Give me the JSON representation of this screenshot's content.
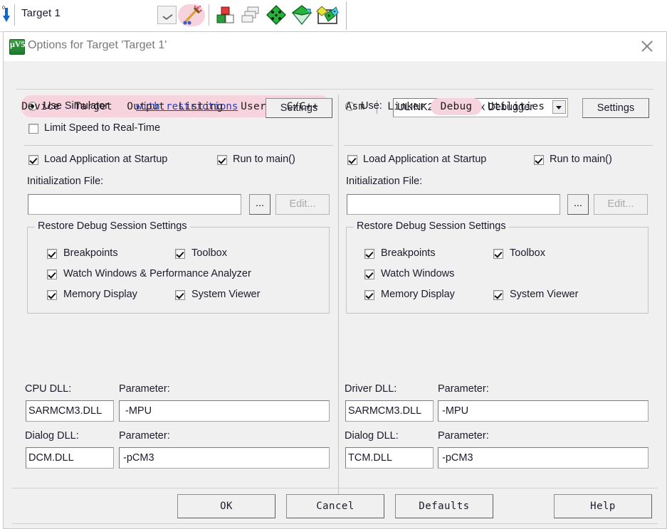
{
  "ide_toolbar": {
    "target_selector_value": "Target 1",
    "icons": [
      {
        "name": "download-arrow-icon"
      },
      {
        "name": "dropdown-arrow-icon"
      },
      {
        "name": "magic-wand-target-options-icon",
        "highlighted": true
      },
      {
        "name": "build-target-icon"
      },
      {
        "name": "batch-build-icon"
      },
      {
        "name": "manage-components-icon"
      },
      {
        "name": "pack-filter-icon"
      },
      {
        "name": "pack-installer-icon"
      }
    ]
  },
  "dialog": {
    "title": "Options for Target 'Target 1'",
    "app_icon_text": "μV5",
    "close_label": "✕"
  },
  "tabs": {
    "items": [
      {
        "label": "Device",
        "selected": false
      },
      {
        "label": "Target",
        "selected": false
      },
      {
        "label": "Output",
        "selected": false
      },
      {
        "label": "Listing",
        "selected": false
      },
      {
        "label": "User",
        "selected": false
      },
      {
        "label": "C/C++",
        "selected": false
      },
      {
        "label": "Asm",
        "selected": false
      },
      {
        "label": "Linker",
        "selected": false
      },
      {
        "label": "Debug",
        "selected": true
      },
      {
        "label": "Utilities",
        "selected": false
      }
    ],
    "selected_label": "Debug"
  },
  "left_panel": {
    "use_simulator_label": "Use Simulator",
    "use_simulator_checked": true,
    "with_restrictions_link": "with restrictions",
    "settings_button": "Settings",
    "limit_speed_label": "Limit Speed to Real-Time",
    "limit_speed_checked": false,
    "load_app_label": "Load Application at Startup",
    "load_app_checked": true,
    "run_to_main_label": "Run to main()",
    "run_to_main_checked": true,
    "init_file_label": "Initialization File:",
    "init_file_value": "",
    "browse_button": "...",
    "edit_button": "Edit...",
    "edit_button_enabled": false,
    "restore_group_caption": "Restore Debug Session Settings",
    "restore_items": [
      {
        "label": "Breakpoints",
        "checked": true
      },
      {
        "label": "Toolbox",
        "checked": true
      },
      {
        "label": "Watch Windows & Performance Analyzer",
        "checked": true
      },
      {
        "label": "Memory Display",
        "checked": true
      },
      {
        "label": "System Viewer",
        "checked": true
      }
    ],
    "cpu_dll_label": "CPU DLL:",
    "cpu_dll_value": "SARMCM3.DLL",
    "cpu_param_label": "Parameter:",
    "cpu_param_value": "-MPU",
    "dialog_dll_label": "Dialog DLL:",
    "dialog_dll_value": "DCM.DLL",
    "dialog_param_label": "Parameter:",
    "dialog_param_value": "-pCM3"
  },
  "right_panel": {
    "use_label": "Use:",
    "use_checked": false,
    "debugger_value": "ULINK2/ME Cortex Debugger",
    "settings_button": "Settings",
    "load_app_label": "Load Application at Startup",
    "load_app_checked": true,
    "run_to_main_label": "Run to main()",
    "run_to_main_checked": true,
    "init_file_label": "Initialization File:",
    "init_file_value": "",
    "browse_button": "...",
    "edit_button": "Edit...",
    "edit_button_enabled": false,
    "restore_group_caption": "Restore Debug Session Settings",
    "restore_items": [
      {
        "label": "Breakpoints",
        "checked": true
      },
      {
        "label": "Toolbox",
        "checked": true
      },
      {
        "label": "Watch Windows",
        "checked": true
      },
      {
        "label": "Memory Display",
        "checked": true
      },
      {
        "label": "System Viewer",
        "checked": true
      }
    ],
    "driver_dll_label": "Driver DLL:",
    "driver_dll_value": "SARMCM3.DLL",
    "driver_param_label": "Parameter:",
    "driver_param_value": "-MPU",
    "dialog_dll_label": "Dialog DLL:",
    "dialog_dll_value": "TCM.DLL",
    "dialog_param_label": "Parameter:",
    "dialog_param_value": "-pCM3"
  },
  "footer": {
    "ok": "OK",
    "cancel": "Cancel",
    "defaults": "Defaults",
    "help": "Help"
  },
  "colors": {
    "highlight_pink": "#f7d3dd",
    "link_blue": "#1f3fd0",
    "dialog_bg": "#f0f0f0",
    "title_gray": "#787878"
  }
}
